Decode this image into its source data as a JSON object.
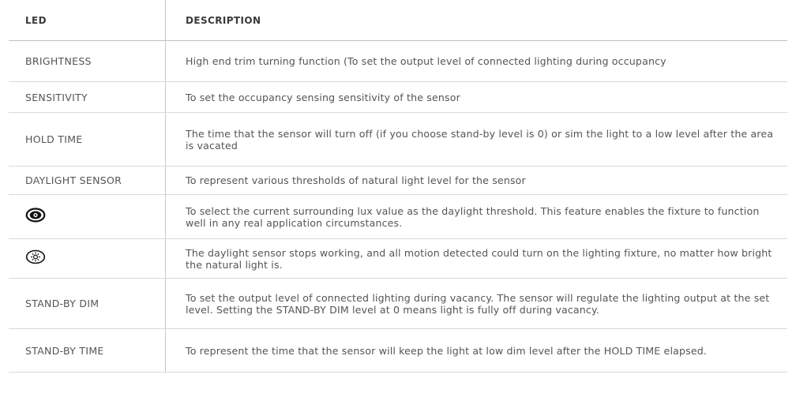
{
  "header": {
    "led": "LED",
    "description": "DESCRIPTION"
  },
  "rows": [
    {
      "led": "BRIGHTNESS",
      "description": "High end trim turning function (To set the output level of connected lighting during occupancy"
    },
    {
      "led": "SENSITIVITY",
      "description": "To set the occupancy sensing sensitivity of the sensor"
    },
    {
      "led": "HOLD TIME",
      "description": "The time that the sensor will turn off (if you choose stand-by level is 0) or sim the light to a low level after the area is vacated"
    },
    {
      "led": "DAYLIGHT SENSOR",
      "description": "To represent various thresholds of natural light level for the sensor"
    },
    {
      "led_icon": "eye-icon",
      "description": "To select the current surrounding lux value as the daylight threshold. This feature enables the fixture to function well in any real application circumstances."
    },
    {
      "led_icon": "sun-icon",
      "description": "The daylight sensor stops working, and all motion detected could turn on the lighting fixture, no matter how bright the natural light is."
    },
    {
      "led": "STAND-BY DIM",
      "description": "To set the output level of connected lighting during vacancy. The sensor will regulate the lighting output at the set level. Setting the STAND-BY DIM level at 0 means light is fully off during vacancy."
    },
    {
      "led": "STAND-BY TIME",
      "description": "To represent the time that the sensor will keep the light at low dim level after the HOLD TIME elapsed."
    }
  ]
}
